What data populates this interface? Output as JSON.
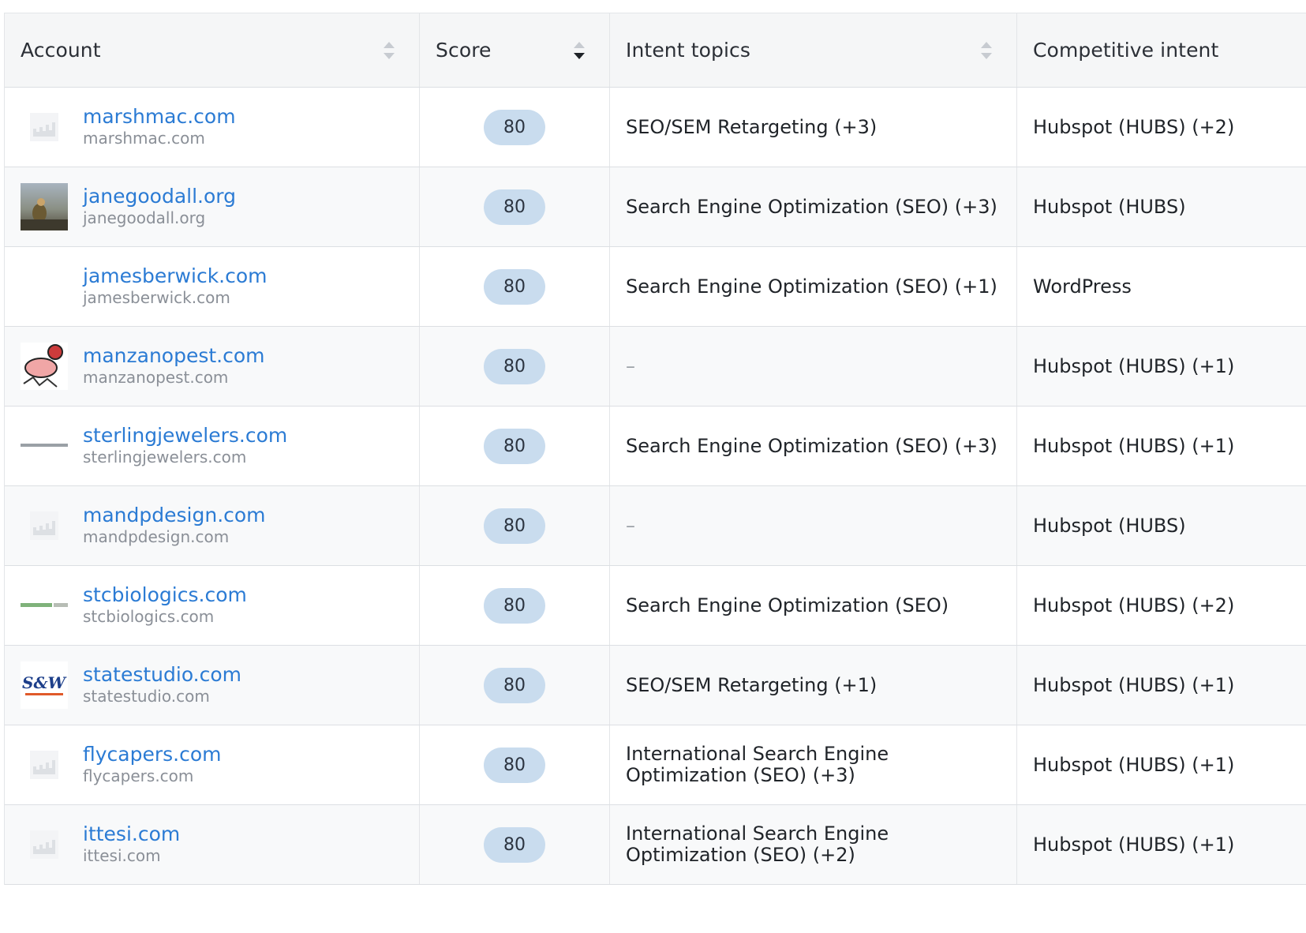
{
  "table": {
    "headers": {
      "account": "Account",
      "score": "Score",
      "intent": "Intent topics",
      "competitive": "Competitive intent"
    },
    "rows": [
      {
        "domain": "marshmac.com",
        "subdomain": "marshmac.com",
        "score": "80",
        "intent": "SEO/SEM Retargeting (+3)",
        "competitive": "Hubspot (HUBS) (+2)",
        "logo": "factory-placeholder-icon"
      },
      {
        "domain": "janegoodall.org",
        "subdomain": "janegoodall.org",
        "score": "80",
        "intent": "Search Engine Optimization (SEO) (+3)",
        "competitive": "Hubspot (HUBS)",
        "logo": "photo-logo"
      },
      {
        "domain": "jamesberwick.com",
        "subdomain": "jamesberwick.com",
        "score": "80",
        "intent": "Search Engine Optimization (SEO) (+1)",
        "competitive": "WordPress",
        "logo": "none"
      },
      {
        "domain": "manzanopest.com",
        "subdomain": "manzanopest.com",
        "score": "80",
        "intent": "–",
        "competitive": "Hubspot (HUBS) (+1)",
        "logo": "cartoon-logo"
      },
      {
        "domain": "sterlingjewelers.com",
        "subdomain": "sterlingjewelers.com",
        "score": "80",
        "intent": "Search Engine Optimization (SEO) (+3)",
        "competitive": "Hubspot (HUBS) (+1)",
        "logo": "wordmark-logo"
      },
      {
        "domain": "mandpdesign.com",
        "subdomain": "mandpdesign.com",
        "score": "80",
        "intent": "–",
        "competitive": "Hubspot (HUBS)",
        "logo": "factory-placeholder-icon"
      },
      {
        "domain": "stcbiologics.com",
        "subdomain": "stcbiologics.com",
        "score": "80",
        "intent": "Search Engine Optimization (SEO)",
        "competitive": "Hubspot (HUBS) (+2)",
        "logo": "green-wordmark-logo"
      },
      {
        "domain": "statestudio.com",
        "subdomain": "statestudio.com",
        "score": "80",
        "intent": "SEO/SEM Retargeting (+1)",
        "competitive": "Hubspot (HUBS) (+1)",
        "logo": "script-logo"
      },
      {
        "domain": "flycapers.com",
        "subdomain": "flycapers.com",
        "score": "80",
        "intent": "International Search Engine Optimization (SEO) (+3)",
        "competitive": "Hubspot (HUBS) (+1)",
        "logo": "factory-placeholder-icon"
      },
      {
        "domain": "ittesi.com",
        "subdomain": "ittesi.com",
        "score": "80",
        "intent": "International Search Engine Optimization (SEO) (+2)",
        "competitive": "Hubspot (HUBS) (+1)",
        "logo": "factory-placeholder-icon"
      }
    ]
  },
  "colors": {
    "link": "#2b7bd4",
    "pill": "#c9dcee",
    "header_bg": "#f5f6f7",
    "row_alt_bg": "#f8f9fa"
  }
}
